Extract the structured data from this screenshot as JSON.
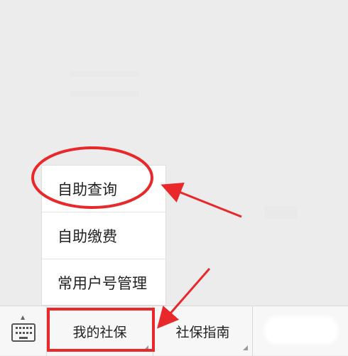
{
  "popup_menu": {
    "items": [
      "自助查询",
      "自助缴费",
      "常用户号管理"
    ]
  },
  "bottom_bar": {
    "keyboard_icon": "keyboard-icon",
    "tabs": [
      "我的社保",
      "社保指南"
    ],
    "third_tab_obscured": true
  },
  "annotation": {
    "color": "#e8282b",
    "highlighted_item": "自助查询",
    "highlighted_tab": "我的社保"
  }
}
